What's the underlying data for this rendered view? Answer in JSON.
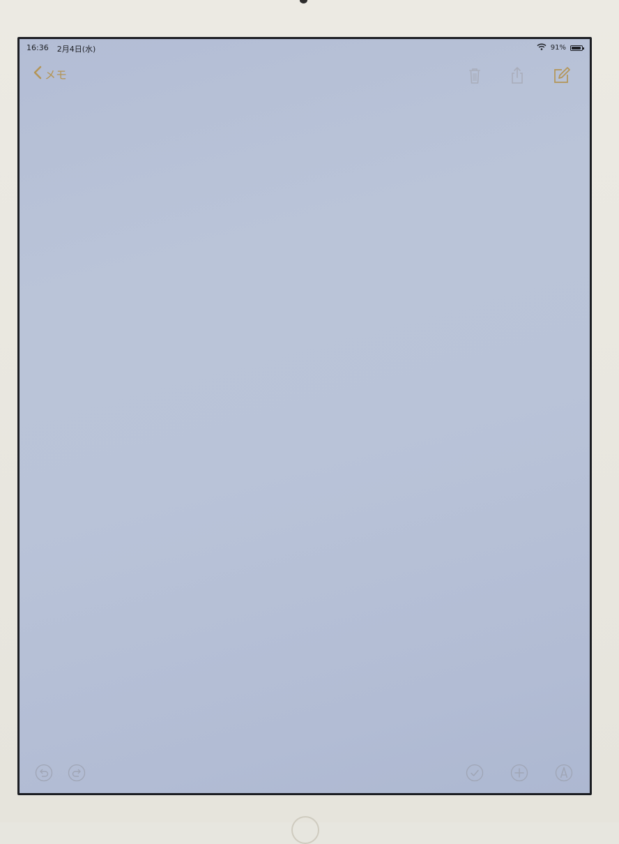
{
  "status": {
    "time": "16:36",
    "date": "2月4日(水)",
    "battery": "91%",
    "battery_level": 0.91
  },
  "nav": {
    "back_label": "メモ"
  },
  "icons": {
    "back": "chevron-left-icon",
    "trash": "trash-icon",
    "share": "share-icon",
    "compose": "compose-icon",
    "undo": "undo-icon",
    "redo": "redo-icon",
    "checklist": "checklist-icon",
    "add": "add-icon",
    "markup": "markup-icon"
  },
  "colors": {
    "accent": "#b49556",
    "disabled": "#a9adba",
    "screen": "#b9c3d8"
  }
}
